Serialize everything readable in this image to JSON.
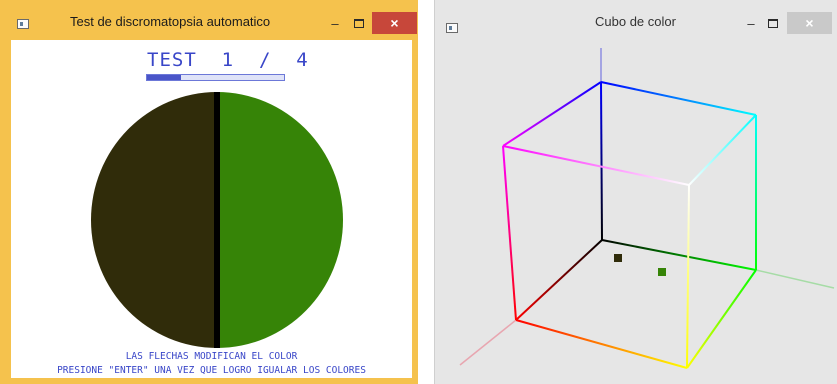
{
  "left_window": {
    "title": "Test de discromatopsia automatico",
    "controls": {
      "minimize": "–",
      "close": "×"
    },
    "test_label": "TEST  1  /  4",
    "progress": 0.25,
    "disk": {
      "left_color": "#302c0a",
      "right_color": "#368407",
      "divider_color": "#000000"
    },
    "instructions": [
      "LAS FLECHAS MODIFICAN EL COLOR",
      "PRESIONE \"ENTER\" UNA VEZ QUE LOGRO IGUALAR LOS COLORES"
    ]
  },
  "right_window": {
    "title": "Cubo de color",
    "controls": {
      "minimize": "–",
      "close": "×"
    },
    "markers": [
      {
        "name": "left-color-marker",
        "color": "#302c0a"
      },
      {
        "name": "right-color-marker",
        "color": "#368407"
      }
    ]
  },
  "colors": {
    "left_frame": "#f5c24d",
    "right_background": "#e6e6e6",
    "text_blue": "#3946c8",
    "close_red": "#c7473a"
  }
}
